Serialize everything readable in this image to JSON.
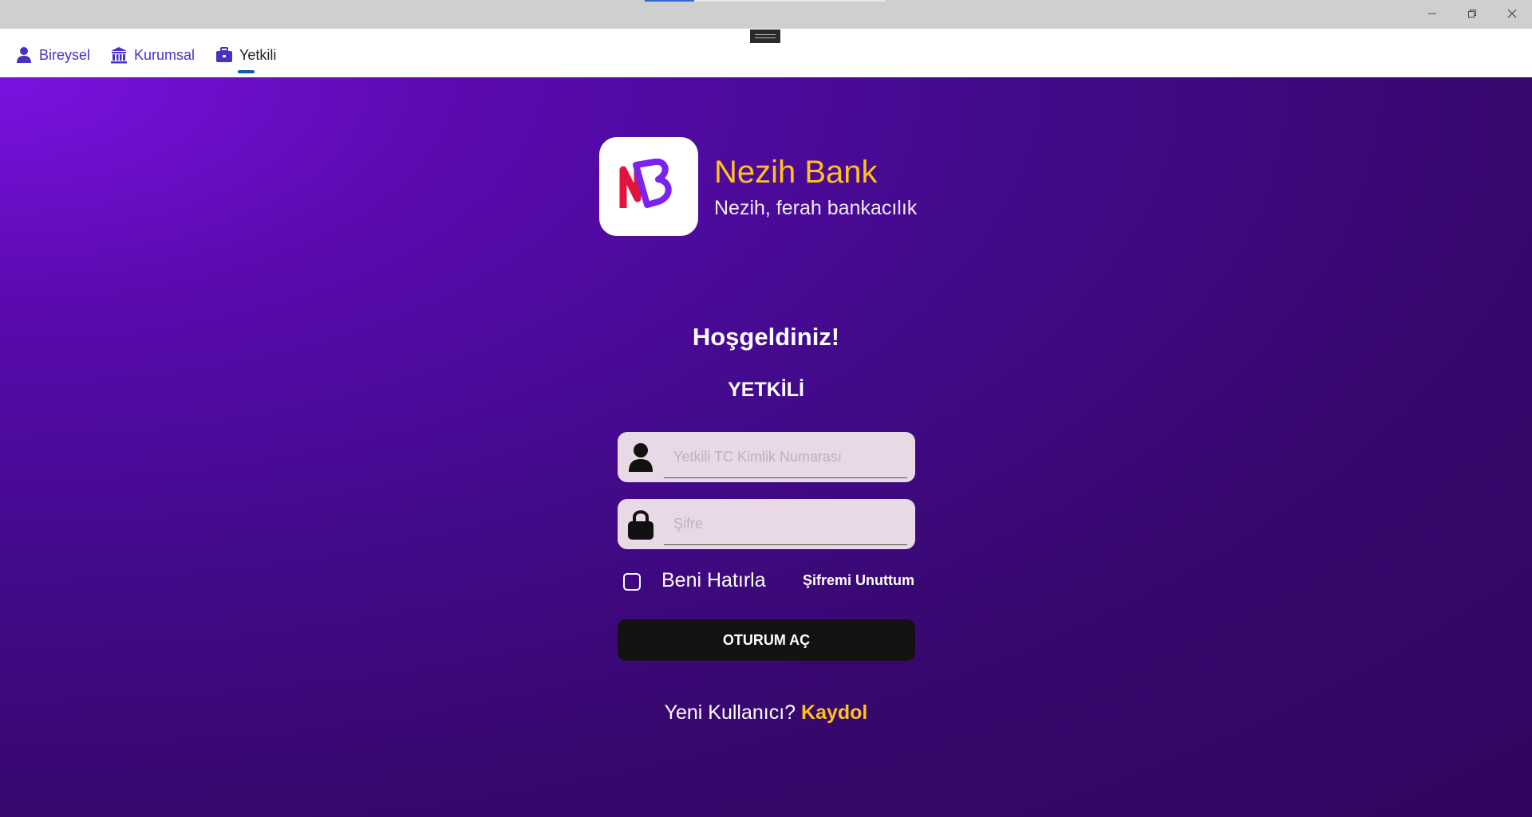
{
  "tabs": {
    "bireysel": "Bireysel",
    "kurumsal": "Kurumsal",
    "yetkili": "Yetkili",
    "active": "yetkili"
  },
  "brand": {
    "name": "Nezih Bank",
    "slogan": "Nezih, ferah bankacılık",
    "logo_letters": "NB"
  },
  "login": {
    "welcome": "Hoşgeldiniz!",
    "role": "YETKİLİ",
    "tc_placeholder": "Yetkili TC Kimlik Numarası",
    "password_placeholder": "Şifre",
    "remember_label": "Beni Hatırla",
    "forgot_label": "Şifremi Unuttum",
    "submit_label": "OTURUM AÇ",
    "new_user_prompt": "Yeni Kullanıcı?",
    "signup_label": "Kaydol"
  },
  "colors": {
    "accent_yellow": "#ffc21a",
    "tab_blue": "#4a2fc4",
    "background_purple": "#3a0a7a",
    "button_dark": "#131313",
    "field_bg": "#e9d8e6"
  },
  "icons": {
    "tab_bireysel": "person-icon",
    "tab_kurumsal": "bank-icon",
    "tab_yetkili": "briefcase-icon",
    "tc_field": "person-icon",
    "password_field": "lock-icon"
  }
}
